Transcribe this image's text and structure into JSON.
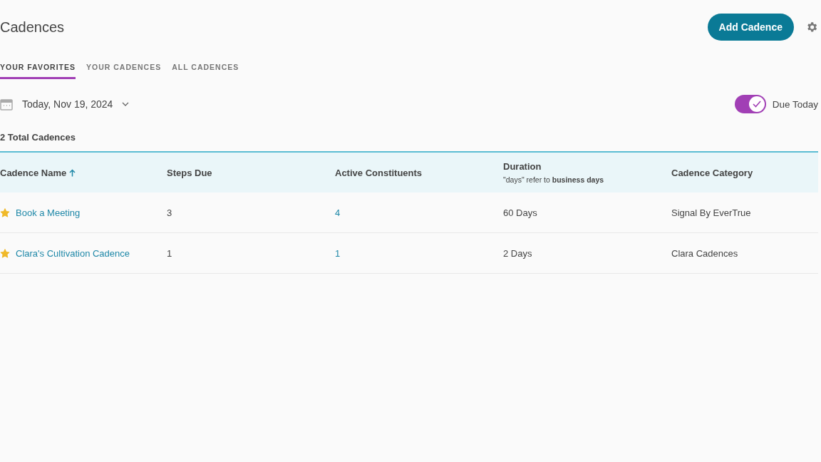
{
  "header": {
    "title": "Cadences",
    "add_button": "Add Cadence"
  },
  "tabs": [
    {
      "label": "YOUR FAVORITES",
      "selected": true
    },
    {
      "label": "YOUR CADENCES",
      "selected": false
    },
    {
      "label": "ALL CADENCES",
      "selected": false
    }
  ],
  "date_picker": {
    "value": "Today, Nov 19, 2024"
  },
  "due_today": {
    "label": "Due Today",
    "on": true
  },
  "total": "2 Total Cadences",
  "table": {
    "columns": [
      {
        "label": "Cadence Name",
        "sorted": true
      },
      {
        "label": "Steps Due",
        "sorted": false
      },
      {
        "label": "Active Constituents",
        "sorted": false
      },
      {
        "label": "Duration",
        "sorted": false,
        "note": "\"days\" refer to **business days**"
      },
      {
        "label": "Cadence Category",
        "sorted": false
      }
    ],
    "rows": [
      {
        "favorite": true,
        "name": "Book a Meeting",
        "steps_due": "3",
        "active_constituents": "4",
        "duration": "60 Days",
        "category": "Signal By EverTrue"
      },
      {
        "favorite": true,
        "name": "Clara's Cultivation Cadence",
        "steps_due": "1",
        "active_constituents": "1",
        "duration": "2 Days",
        "category": "Clara Cadences"
      }
    ]
  }
}
